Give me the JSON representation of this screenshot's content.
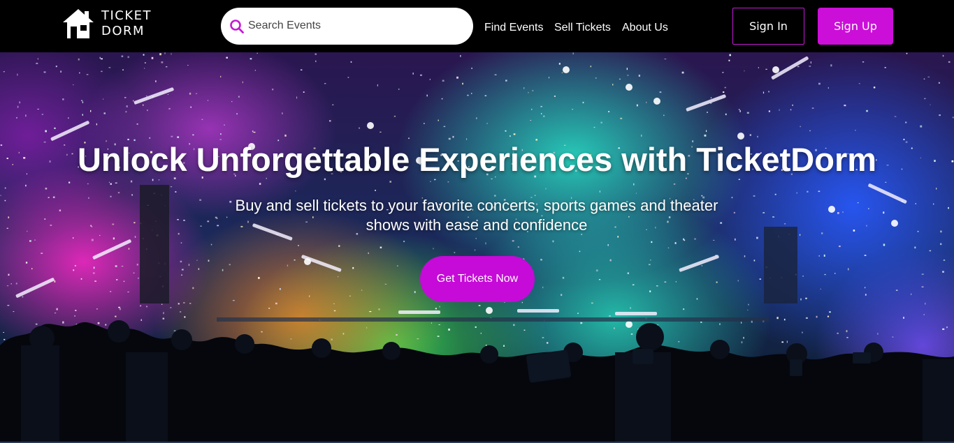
{
  "brand": {
    "logo_line1": "TICKET",
    "logo_line2": "DORM",
    "logo_icon": "house-icon"
  },
  "search": {
    "placeholder": "Search Events",
    "icon": "search-icon"
  },
  "nav": {
    "links": [
      "Find Events",
      "Sell Tickets",
      "About Us"
    ],
    "sign_in_label": "Sign In",
    "sign_up_label": "Sign Up"
  },
  "hero": {
    "title": "Unlock Unforgettable Experiences with TicketDorm",
    "subtitle": "Buy and sell tickets to your favorite concerts, sports games and theater shows with ease and confidence",
    "cta_label": "Get Tickets Now"
  },
  "colors": {
    "accent": "#cc0ed9",
    "nav_bg": "#000000",
    "text": "#ffffff"
  }
}
